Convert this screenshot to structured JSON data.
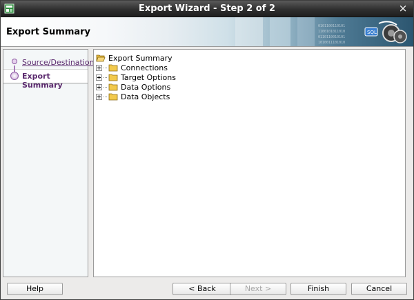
{
  "window": {
    "title": "Export Wizard - Step 2 of 2",
    "close_glyph": "×"
  },
  "header": {
    "title": "Export Summary",
    "logo_icon": "export-logo-icon"
  },
  "steps": [
    {
      "label": "Source/Destination",
      "state": "link"
    },
    {
      "label": "Export Summary",
      "state": "current"
    }
  ],
  "tree": {
    "root": "Export Summary",
    "items": [
      {
        "label": "Connections"
      },
      {
        "label": "Target Options"
      },
      {
        "label": "Data Options"
      },
      {
        "label": "Data Objects"
      }
    ]
  },
  "buttons": {
    "help": "Help",
    "back": "< Back",
    "next": "Next >",
    "finish": "Finish",
    "cancel": "Cancel"
  },
  "colors": {
    "step_link": "#5b2a6e",
    "folder": "#f2c94c",
    "title_bar": "#2f2f2f"
  }
}
